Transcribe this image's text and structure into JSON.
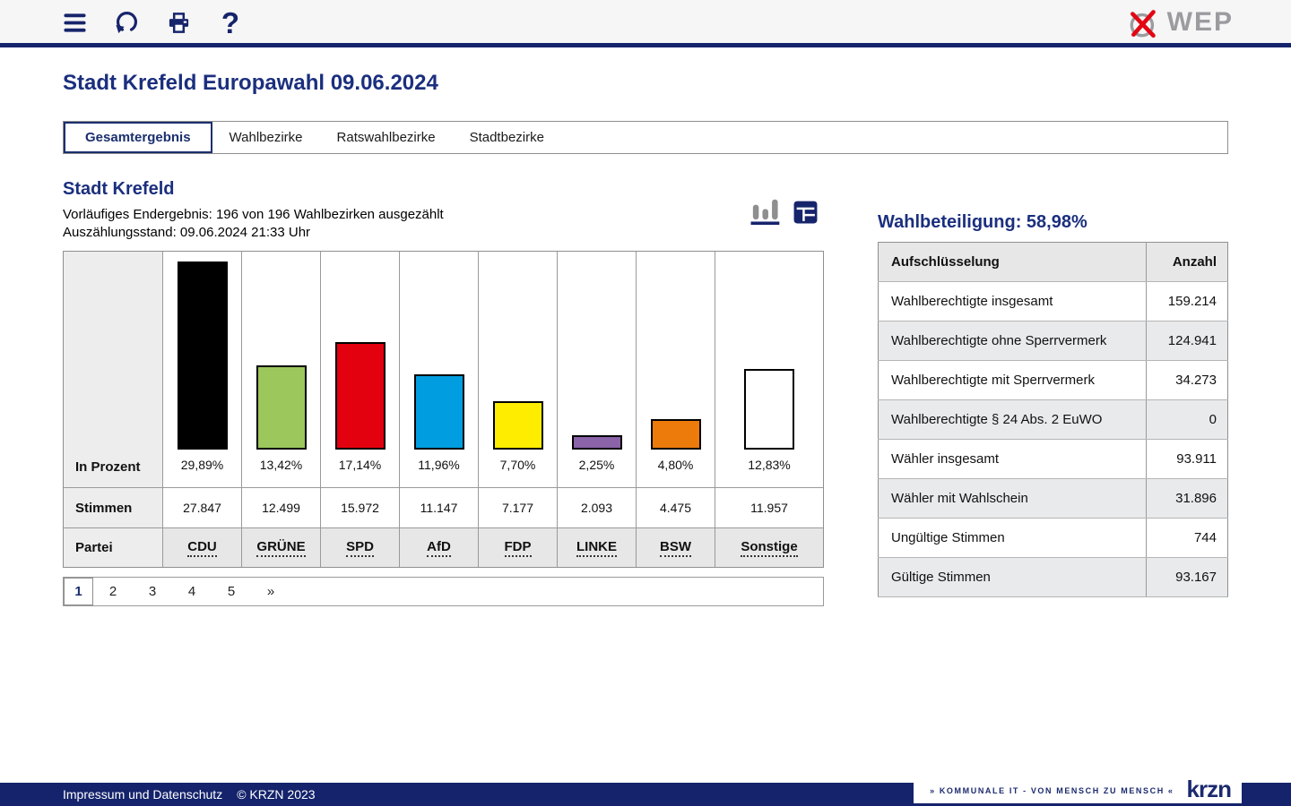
{
  "page": {
    "title": "Stadt Krefeld Europawahl 09.06.2024"
  },
  "header": {
    "icons": [
      "menu-icon",
      "refresh-icon",
      "print-icon",
      "help-icon"
    ],
    "help_glyph": "?",
    "logo_text": "WEP",
    "colors": {
      "navy": "#16246b",
      "logo_gray": "#9b9ba0",
      "logo_red": "#e30613"
    }
  },
  "tabs": [
    {
      "label": "Gesamtergebnis",
      "active": true
    },
    {
      "label": "Wahlbezirke",
      "active": false
    },
    {
      "label": "Ratswahlbezirke",
      "active": false
    },
    {
      "label": "Stadtbezirke",
      "active": false
    }
  ],
  "result": {
    "title": "Stadt Krefeld",
    "status_line1": "Vorläufiges Endergebnis: 196 von 196 Wahlbezirken ausgezählt",
    "status_line2": "Auszählungsstand: 09.06.2024 21:33 Uhr",
    "row_labels": {
      "percent": "In Prozent",
      "votes": "Stimmen",
      "party": "Partei"
    }
  },
  "chart_data": {
    "type": "bar",
    "title": "Stadt Krefeld Europawahl 09.06.2024 Gesamtergebnis",
    "categories": [
      "CDU",
      "GRÜNE",
      "SPD",
      "AfD",
      "FDP",
      "LINKE",
      "BSW",
      "Sonstige"
    ],
    "series": [
      {
        "name": "In Prozent",
        "values": [
          29.89,
          13.42,
          17.14,
          11.96,
          7.7,
          2.25,
          4.8,
          12.83
        ],
        "labels": [
          "29,89%",
          "13,42%",
          "17,14%",
          "11,96%",
          "7,70%",
          "2,25%",
          "4,80%",
          "12,83%"
        ]
      },
      {
        "name": "Stimmen",
        "values": [
          27847,
          12499,
          15972,
          11147,
          7177,
          2093,
          4475,
          11957
        ],
        "labels": [
          "27.847",
          "12.499",
          "15.972",
          "11.147",
          "7.177",
          "2.093",
          "4.475",
          "11.957"
        ]
      }
    ],
    "colors": [
      "#000000",
      "#9bc75c",
      "#e3000f",
      "#009ee0",
      "#ffed00",
      "#8a63a8",
      "#ec7b0c",
      "#ffffff"
    ],
    "bar_border_color": "#000000",
    "xlabel": "",
    "ylabel": "In Prozent",
    "ylim": [
      0,
      31.5
    ],
    "grid": false,
    "legend_position": "none"
  },
  "pagination": {
    "pages": [
      "1",
      "2",
      "3",
      "4",
      "5",
      "»"
    ],
    "active": "1"
  },
  "turnout": {
    "title": "Wahlbeteiligung: 58,98%",
    "columns": {
      "label": "Aufschlüsselung",
      "value": "Anzahl"
    },
    "rows": [
      {
        "label": "Wahlberechtigte insgesamt",
        "value": "159.214"
      },
      {
        "label": "Wahlberechtigte ohne Sperrvermerk",
        "value": "124.941"
      },
      {
        "label": "Wahlberechtigte mit Sperrvermerk",
        "value": "34.273"
      },
      {
        "label": "Wahlberechtigte § 24 Abs. 2 EuWO",
        "value": "0"
      },
      {
        "label": "Wähler insgesamt",
        "value": "93.911"
      },
      {
        "label": "Wähler mit Wahlschein",
        "value": "31.896"
      },
      {
        "label": "Ungültige Stimmen",
        "value": "744"
      },
      {
        "label": "Gültige Stimmen",
        "value": "93.167"
      }
    ]
  },
  "footer": {
    "link": "Impressum und Datenschutz",
    "copyright": "© KRZN 2023",
    "logo_tagline": "» KOMMUNALE IT - VON MENSCH ZU MENSCH «",
    "logo_text": "krzn"
  }
}
